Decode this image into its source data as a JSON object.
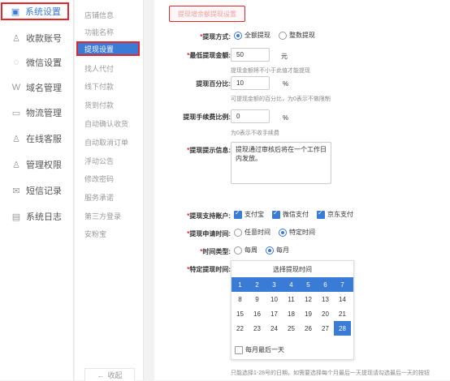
{
  "left_nav": [
    {
      "label": "系统设置",
      "icon": "settings-icon",
      "active": true
    },
    {
      "label": "收款账号",
      "icon": "user-icon"
    },
    {
      "label": "微信设置",
      "icon": "wechat-icon"
    },
    {
      "label": "域名管理",
      "icon": "domain-icon"
    },
    {
      "label": "物流管理",
      "icon": "truck-icon"
    },
    {
      "label": "在线客服",
      "icon": "service-icon"
    },
    {
      "label": "管理权限",
      "icon": "admin-icon"
    },
    {
      "label": "短信记录",
      "icon": "sms-icon"
    },
    {
      "label": "系统日志",
      "icon": "log-icon"
    }
  ],
  "sub_nav": [
    "店铺信息",
    "功能名称",
    "提现设置",
    "找人代付",
    "线下付款",
    "货到付款",
    "自动确认收货",
    "自动取消订单",
    "浮动公告",
    "修改密码",
    "服务承诺",
    "第三方登录",
    "安粉宝"
  ],
  "collapse_label": "收起",
  "section_title": "提现增余额提现设置",
  "form": {
    "method_label": "提现方式:",
    "method_options": [
      "全额提现",
      "整数提现"
    ],
    "min_label": "最低提现金额:",
    "min_value": "50",
    "min_unit": "元",
    "min_hint": "提现金额将不小于此值才能提现",
    "percent_label": "提现百分比:",
    "percent_value": "10",
    "percent_unit": "%",
    "percent_hint": "可提现金额的百分比，为0表示不做限制",
    "fee_label": "提现手续费比例:",
    "fee_value": "0",
    "fee_unit": "%",
    "fee_hint": "为0表示不收手续费",
    "tip_label": "提现提示信息:",
    "tip_value": "提现通过审核后将在一个工作日内发放。",
    "account_label": "提现支持账户:",
    "accounts": [
      "支付宝",
      "微信支付",
      "京东支付"
    ],
    "apply_label": "提现申请时间:",
    "apply_options": [
      "任意时间",
      "特定时间"
    ],
    "type_label": "时间类型:",
    "type_options": [
      "每周",
      "每月"
    ],
    "specific_label": "特定提现时间:",
    "calendar_title": "选择提现时间",
    "calendar_rows": [
      [
        "1",
        "2",
        "3",
        "4",
        "5",
        "6",
        "7"
      ],
      [
        "8",
        "9",
        "10",
        "11",
        "12",
        "13",
        "14"
      ],
      [
        "15",
        "16",
        "17",
        "18",
        "19",
        "20",
        "21"
      ],
      [
        "22",
        "23",
        "24",
        "25",
        "26",
        "27",
        "28"
      ]
    ],
    "last_day_label": "每月最后一天",
    "bottom_note": "只能选择1-28号的日期，如需要选择每个月最后一天提现请勾选最后一天的按钮"
  }
}
